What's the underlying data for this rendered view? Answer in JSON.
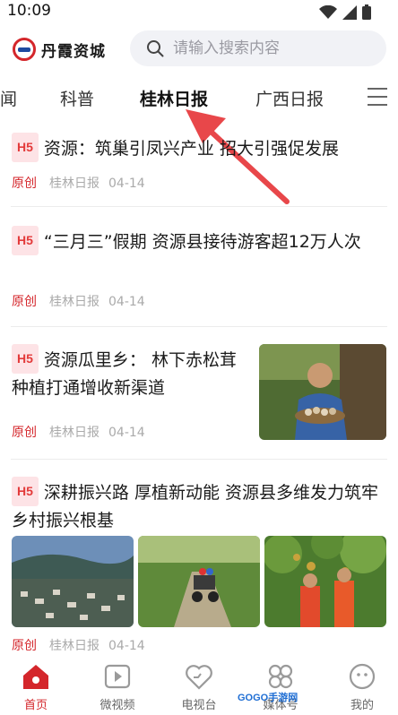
{
  "status": {
    "time": "10:09"
  },
  "header": {
    "brand": "丹霞资城"
  },
  "search": {
    "placeholder": "请输入搜索内容"
  },
  "tabs": [
    {
      "label": "闻"
    },
    {
      "label": "科普"
    },
    {
      "label": "桂林日报",
      "active": true
    },
    {
      "label": "广西日报"
    }
  ],
  "articles": [
    {
      "badge": "H5",
      "title": "资源：筑巢引凤兴产业 招大引强促发展",
      "origin": "原创",
      "source": "桂林日报",
      "date": "04-14"
    },
    {
      "badge": "H5",
      "title": "“三月三”假期 资源县接待游客超12万人次",
      "origin": "原创",
      "source": "桂林日报",
      "date": "04-14"
    },
    {
      "badge": "H5",
      "title": "资源瓜里乡： 林下赤松茸种植打通增收新渠道",
      "origin": "原创",
      "source": "桂林日报",
      "date": "04-14"
    },
    {
      "badge": "H5",
      "title": "深耕振兴路 厚植新动能 资源县多维发力筑牢乡村振兴根基",
      "origin": "原创",
      "source": "桂林日报",
      "date": "04-14"
    }
  ],
  "bottom_nav": [
    {
      "label": "首页",
      "icon": "home-icon",
      "active": true
    },
    {
      "label": "微视频",
      "icon": "video-icon"
    },
    {
      "label": "电视台",
      "icon": "tv-heart-icon"
    },
    {
      "label": "媒体号",
      "icon": "media-icon"
    },
    {
      "label": "我的",
      "icon": "profile-icon"
    }
  ],
  "watermark": "GOGO手游网",
  "colors": {
    "accent": "#d4262b",
    "badge_bg": "#fde3e6",
    "annotation_arrow": "#e8474a"
  }
}
